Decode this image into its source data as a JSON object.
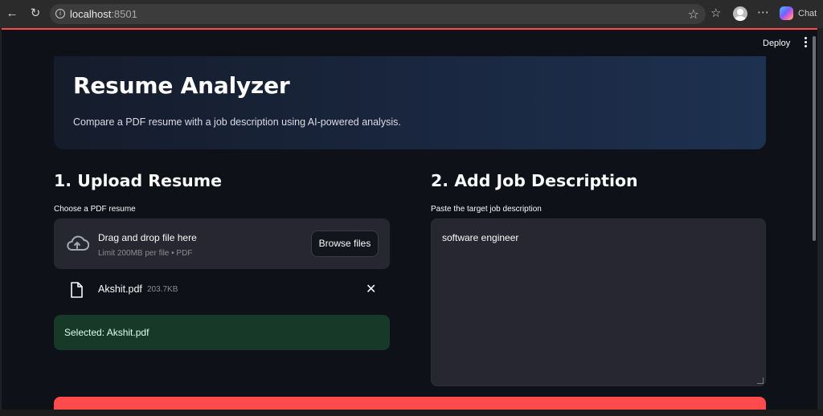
{
  "browser": {
    "url_host": "localhost",
    "url_port": ":8501",
    "chat_label": "Chat"
  },
  "toolbar": {
    "deploy_label": "Deploy"
  },
  "hero": {
    "title": "Resume Analyzer",
    "subtitle": "Compare a PDF resume with a job description using AI-powered analysis."
  },
  "upload": {
    "section_title": "1. Upload Resume",
    "field_label": "Choose a PDF resume",
    "dropzone_title": "Drag and drop file here",
    "dropzone_subtitle": "Limit 200MB per file • PDF",
    "browse_label": "Browse files",
    "file": {
      "name": "Akshit.pdf",
      "size": "203.7KB"
    },
    "success_message": "Selected: Akshit.pdf"
  },
  "job": {
    "section_title": "2. Add Job Description",
    "field_label": "Paste the target job description",
    "value": "software engineer"
  },
  "colors": {
    "primary": "#ff4b4b",
    "background": "#0e1117",
    "secondary_background": "#262730",
    "success_background": "#173928"
  }
}
